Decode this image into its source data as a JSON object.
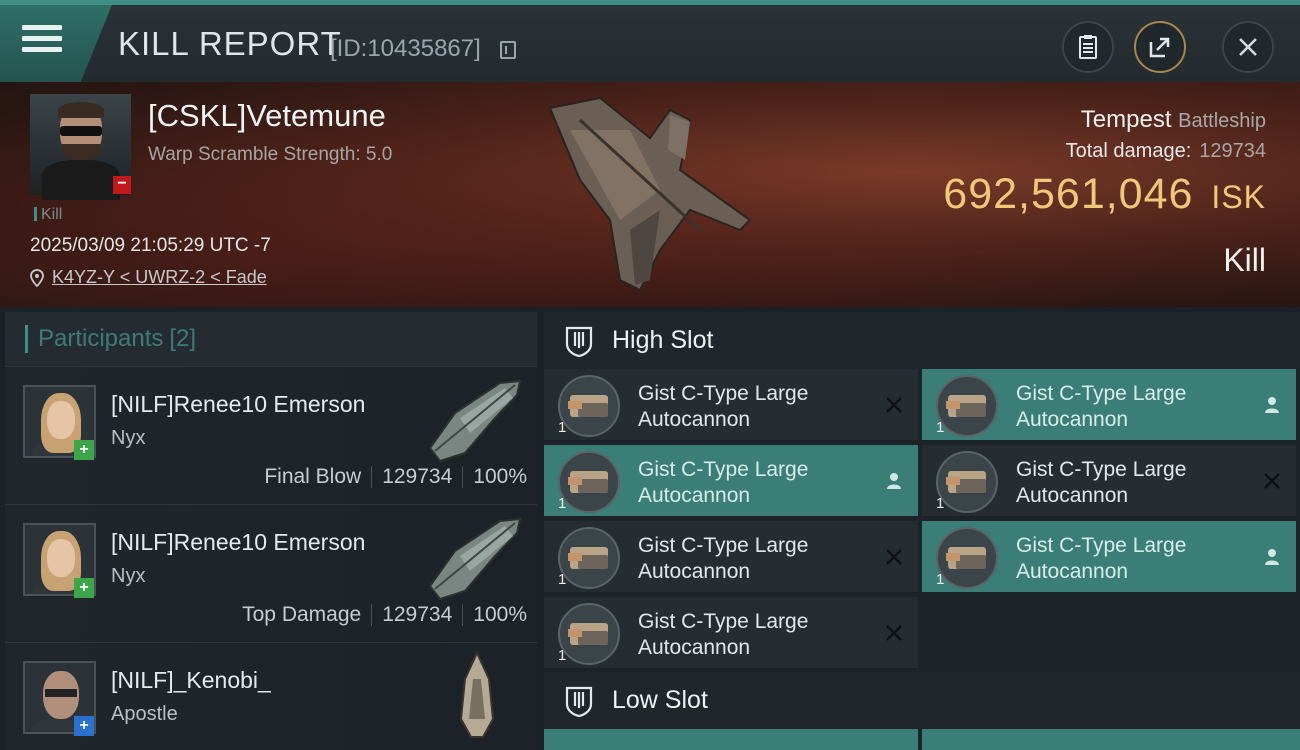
{
  "header": {
    "title": "KILL REPORT",
    "report_id": "[ID:10435867]",
    "copy_icon": "copy-icon",
    "buttons": [
      "clipboard-icon",
      "share-icon",
      "close-icon"
    ]
  },
  "victim": {
    "name": "[CSKL]Vetemune",
    "stat": "Warp Scramble Strength: 5.0",
    "tag": "Kill",
    "datetime": "2025/03/09 21:05:29 UTC -7",
    "location": "K4YZ-Y < UWRZ-2 < Fade",
    "ship_name": "Tempest",
    "ship_class": "Battleship",
    "total_damage_label": "Total damage:",
    "total_damage": "129734",
    "isk_value": "692,561,046",
    "isk_unit": "ISK",
    "result": "Kill",
    "colors": {
      "isk": "#f3c77a",
      "badge": "#c0191c"
    }
  },
  "participants": {
    "title": "Participants",
    "count": "[2]",
    "rows": [
      {
        "name": "[NILF]Renee10 Emerson",
        "ship": "Nyx",
        "role": "Final Blow",
        "damage": "129734",
        "percent": "100%",
        "badge": "+"
      },
      {
        "name": "[NILF]Renee10 Emerson",
        "ship": "Nyx",
        "role": "Top Damage",
        "damage": "129734",
        "percent": "100%",
        "badge": "+"
      },
      {
        "name": "[NILF]_Kenobi_",
        "ship": "Apostle",
        "role": "",
        "damage": "",
        "percent": "",
        "badge": "+"
      }
    ]
  },
  "fittings": {
    "high_slot_title": "High Slot",
    "low_slot_title": "Low Slot",
    "modules": [
      {
        "line1": "Gist C-Type Large",
        "line2": "Autocannon",
        "qty": "1",
        "status": "destroyed"
      },
      {
        "line1": "Gist C-Type Large",
        "line2": "Autocannon",
        "qty": "1",
        "status": "dropped"
      },
      {
        "line1": "Gist C-Type Large",
        "line2": "Autocannon",
        "qty": "1",
        "status": "dropped"
      },
      {
        "line1": "Gist C-Type Large",
        "line2": "Autocannon",
        "qty": "1",
        "status": "destroyed"
      },
      {
        "line1": "Gist C-Type Large",
        "line2": "Autocannon",
        "qty": "1",
        "status": "destroyed"
      },
      {
        "line1": "Gist C-Type Large",
        "line2": "Autocannon",
        "qty": "1",
        "status": "dropped"
      },
      {
        "line1": "Gist C-Type Large",
        "line2": "Autocannon",
        "qty": "1",
        "status": "destroyed"
      }
    ]
  }
}
